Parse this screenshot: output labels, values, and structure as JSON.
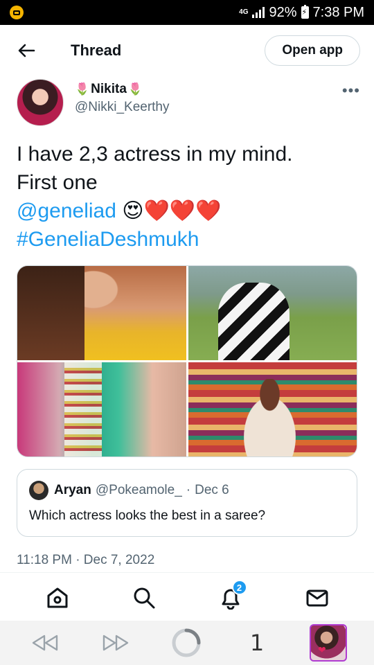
{
  "status_bar": {
    "network": "4G",
    "battery": "92%",
    "time": "7:38 PM"
  },
  "header": {
    "title": "Thread",
    "open_app_label": "Open app"
  },
  "author": {
    "name": "Nikita",
    "name_emoji": "🌷",
    "handle": "@Nikki_Keerthy",
    "more_label": "•••"
  },
  "tweet": {
    "line1": "I have 2,3 actress in my mind.",
    "line2": "First one",
    "mention": "@geneliad",
    "emojis": [
      "😍",
      "❤️",
      "❤️",
      "❤️"
    ],
    "hashtag": "#GeneliaDeshmukh",
    "timestamp": "11:18 PM · Dec 7, 2022"
  },
  "quote": {
    "name": "Aryan",
    "handle": "@Pokeamole_",
    "separator": "·",
    "date": "Dec 6",
    "text": "Which actress looks the best in a saree?"
  },
  "bottom_nav": {
    "notifications_count": "2"
  },
  "system_bar": {
    "tab_count": "1"
  },
  "colors": {
    "link": "#1d9bf0",
    "secondary_text": "#536471",
    "border": "#cfd9de",
    "badge": "#1d9bf0"
  },
  "icons": [
    "back-arrow-icon",
    "more-icon",
    "home-icon",
    "search-icon",
    "notifications-icon",
    "messages-icon",
    "rewind-icon",
    "fast-forward-icon",
    "loading-circle-icon"
  ]
}
